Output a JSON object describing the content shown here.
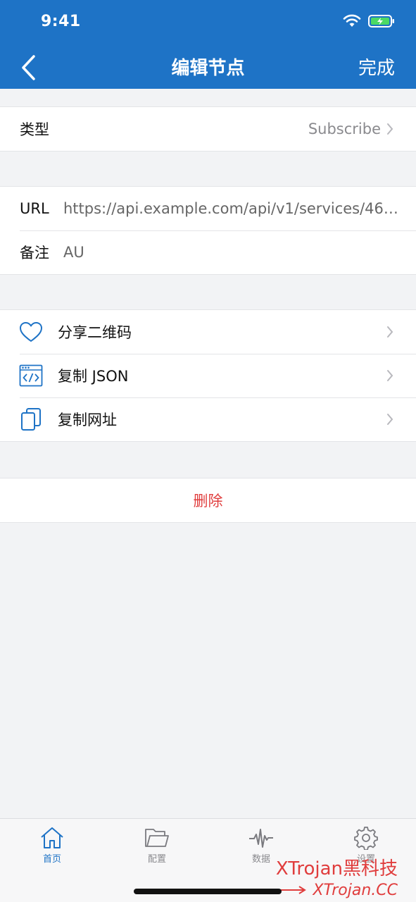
{
  "status": {
    "time": "9:41"
  },
  "nav": {
    "title": "编辑节点",
    "done": "完成"
  },
  "type_row": {
    "label": "类型",
    "value": "Subscribe"
  },
  "details": {
    "url_label": "URL",
    "url_value": "https://api.example.com/api/v1/services/466...",
    "note_label": "备注",
    "note_value": "AU"
  },
  "actions": [
    {
      "label": "分享二维码",
      "icon": "heart-icon"
    },
    {
      "label": "复制 JSON",
      "icon": "code-window-icon"
    },
    {
      "label": "复制网址",
      "icon": "copy-icon"
    }
  ],
  "delete": {
    "label": "删除"
  },
  "tabs": [
    {
      "label": "首页",
      "icon": "home-icon",
      "active": true
    },
    {
      "label": "配置",
      "icon": "folder-icon",
      "active": false
    },
    {
      "label": "数据",
      "icon": "pulse-icon",
      "active": false
    },
    {
      "label": "设置",
      "icon": "gear-icon",
      "active": false
    }
  ],
  "watermark": {
    "line1": "XTrojan黑科技",
    "line2": "XTrojan.CC"
  },
  "colors": {
    "header": "#1e73c6",
    "accent": "#1e73c6",
    "destructive": "#e03d3d",
    "background": "#f2f3f5"
  }
}
